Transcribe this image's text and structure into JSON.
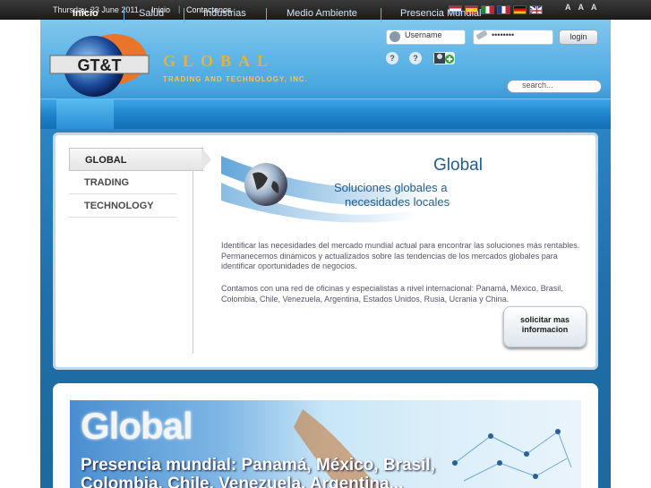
{
  "topbar": {
    "date": "Thursday, 23 June 2011",
    "link_inicio": "Inicio",
    "separator": "|",
    "link_contact": "Contactenos",
    "font_sizes": [
      "A",
      "A",
      "A"
    ]
  },
  "flags": [
    "netherlands",
    "spain",
    "italy",
    "france",
    "germany",
    "united-kingdom"
  ],
  "brand": {
    "logo_text": "GT&T",
    "name": "GLOBAL",
    "subtitle": "TRADING AND TECHNOLOGY, INC."
  },
  "login": {
    "username_value": "Username",
    "password_value": "••••••••",
    "button": "login",
    "help1": "?",
    "help2": "?"
  },
  "search": {
    "placeholder": "search..."
  },
  "nav": {
    "items": [
      "Inicio",
      "Salud",
      "Industrias",
      "Medio Ambiente",
      "Presencia Mundial"
    ],
    "active_index": 0
  },
  "tabs": [
    "GLOBAL",
    "TRADING",
    "TECHNOLOGY"
  ],
  "hero": {
    "title": "Global",
    "line1": "Soluciones globales a",
    "line2": "necesidades locales"
  },
  "body": {
    "p1": "Identificar las necesidades del mercado mundial actual para encontrar las soluciones más rentables. Permanecemos dinámicos y actualizados sobre las tendencias de los mercados globales para identificar oportunidades de negocios.",
    "p2": "Contamos con una red de oficinas y especialistas a nivel internacional: Panamá, México, Brasil, Colombia, Chile, Venezuela, Argentina, Estados Unidos, Rusia, Ucrania y China."
  },
  "cta": {
    "line1": "solicitar mas",
    "line2": "informacion"
  },
  "banner": {
    "word": "Global",
    "line1": "Presencia mundial: Panamá, México, Brasil,",
    "line2": "Colombia, Chile, Venezuela, Argentina..."
  },
  "colors": {
    "topbar": "#1b1b1b",
    "nav": "#1b7fc7",
    "brand_gold": "#e8b23a",
    "text_blue": "#235e8a"
  }
}
